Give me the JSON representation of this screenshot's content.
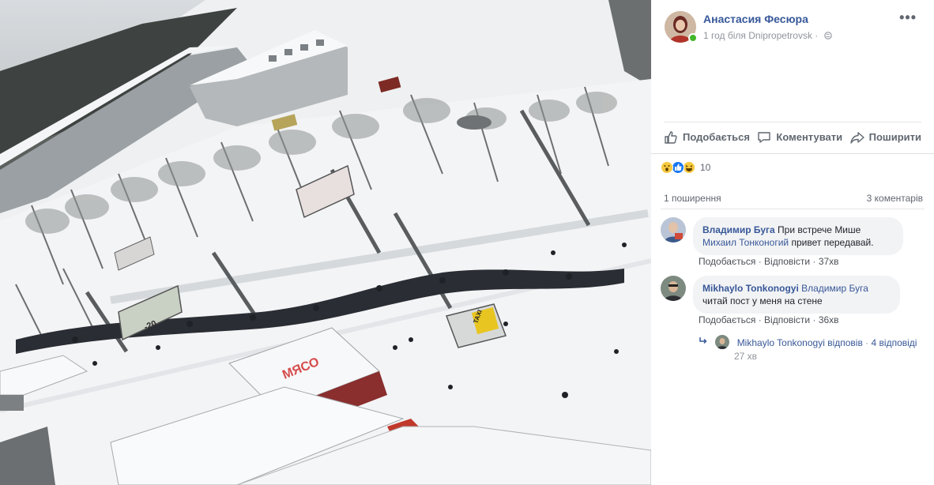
{
  "post": {
    "author": "Анастасия Фесюра",
    "meta": "1 год біля Dnipropetrovsk",
    "more": "•••",
    "signage": {
      "store_sign": "МЯСО",
      "billboard_price": "-20",
      "taxi": "TAXI"
    }
  },
  "actions": {
    "like": "Подобається",
    "comment": "Коментувати",
    "share": "Поширити"
  },
  "reactions": {
    "icons": [
      "wow-icon",
      "like-icon",
      "haha-icon"
    ],
    "count": "10"
  },
  "stats": {
    "shares": "1 поширення",
    "comments": "3 коментарів"
  },
  "comments": [
    {
      "author": "Владимир Буга",
      "text_before": "При встрече Мише",
      "mention": "Михаил Тонконогий",
      "text_after": "привет передавай.",
      "like": "Подобається",
      "reply": "Відповісти",
      "time": "37хв"
    },
    {
      "author": "Mikhaylo Tonkonogyi",
      "mention": "Владимир Буга",
      "text_after": "читай пост у меня на стене",
      "like": "Подобається",
      "reply": "Відповісти",
      "time": "36хв"
    }
  ],
  "replies_summary": {
    "text": "Mikhaylo Tonkonogyi відповів",
    "count": "4 відповіді",
    "time": "27 хв"
  },
  "colors": {
    "link": "#365899",
    "online": "#42b72a",
    "bubble": "#f2f3f5"
  }
}
